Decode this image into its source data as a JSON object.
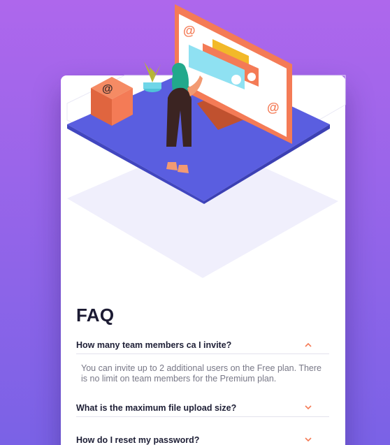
{
  "faq": {
    "title": "FAQ",
    "items": [
      {
        "question": "How many team members ca I invite?",
        "answer": "You can invite up to 2 additional users on the Free plan. There is no limit on team members for the Premium plan.",
        "expanded": true,
        "chevron_icon": "chevron-up-icon"
      },
      {
        "question": "What is the maximum file upload size?",
        "expanded": false,
        "chevron_icon": "chevron-down-icon"
      },
      {
        "question": "How do I reset my password?",
        "expanded": false,
        "chevron_icon": "chevron-down-icon"
      }
    ]
  },
  "colors": {
    "background_top": "#ae67ec",
    "background_bottom": "#7a62e6",
    "chevron": "#f47b56",
    "question_text": "#1e1f36",
    "answer_text": "#787887",
    "divider": "#e3e2ec"
  }
}
